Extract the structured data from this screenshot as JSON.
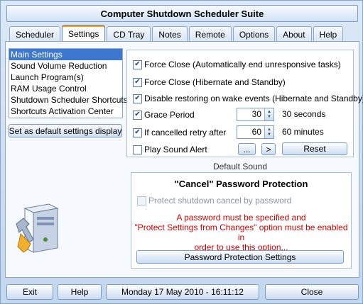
{
  "window": {
    "title": "Computer Shutdown Scheduler Suite"
  },
  "tabs": [
    {
      "label": "Scheduler"
    },
    {
      "label": "Settings"
    },
    {
      "label": "CD Tray"
    },
    {
      "label": "Notes"
    },
    {
      "label": "Remote"
    },
    {
      "label": "Options"
    },
    {
      "label": "About"
    },
    {
      "label": "Help"
    }
  ],
  "settings_list": [
    {
      "label": "Main Settings"
    },
    {
      "label": "Sound Volume Reduction"
    },
    {
      "label": "Launch Program(s)"
    },
    {
      "label": "RAM Usage Control"
    },
    {
      "label": "Shutdown Scheduler Shortcuts"
    },
    {
      "label": "Shortcuts Activation Center"
    }
  ],
  "set_default_label": "Set as default settings display",
  "options": {
    "force_close": {
      "label": "Force Close (Automatically end unresponsive tasks)",
      "checked": true
    },
    "force_close_hibernate": {
      "label": "Force Close (Hibernate and Standby)",
      "checked": true
    },
    "disable_restore": {
      "label": "Disable restoring on wake events (Hibernate and Standby)",
      "checked": true
    },
    "grace_period": {
      "label": "Grace Period",
      "checked": true,
      "value": "30",
      "unit": "30 seconds"
    },
    "retry": {
      "label": "If cancelled retry after",
      "checked": true,
      "value": "60",
      "unit": "60 minutes"
    },
    "sound_alert": {
      "label": "Play Sound Alert",
      "checked": false
    },
    "browse_label": "...",
    "play_label": ">",
    "reset_label": "Reset",
    "default_sound": "Default Sound"
  },
  "password": {
    "title": "\"Cancel\" Password Protection",
    "protect_label": "Protect shutdown cancel by password",
    "warning_line1": "A password must be specified and",
    "warning_line2": "\"Protect Settings from Changes\" option must be enabled in",
    "warning_line3": "order to use this option...",
    "settings_button": "Password Protection Settings",
    "warning_color": "#cc0000"
  },
  "status_bar": {
    "exit_label": "Exit",
    "help_label": "Help",
    "datetime": "Monday 17 May 2010 - 16:11:12",
    "close_label": "Close"
  },
  "check_mark": "✔",
  "spin_up": "▲",
  "spin_down": "▼"
}
